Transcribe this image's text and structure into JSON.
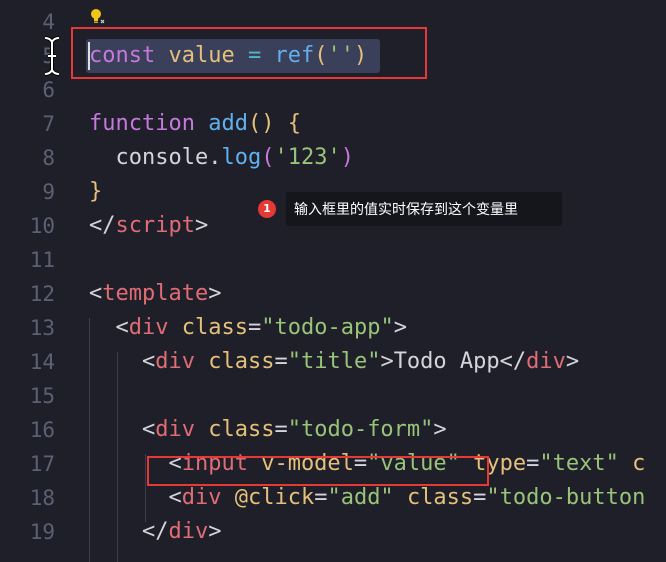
{
  "editor": {
    "lines": [
      {
        "num": "4",
        "tokens": []
      },
      {
        "num": "5",
        "tokens": [
          {
            "t": "const",
            "c": "t-kw"
          },
          {
            "t": " ",
            "c": "t-plain"
          },
          {
            "t": "value",
            "c": "t-var"
          },
          {
            "t": " ",
            "c": "t-plain"
          },
          {
            "t": "=",
            "c": "t-op"
          },
          {
            "t": " ",
            "c": "t-plain"
          },
          {
            "t": "ref",
            "c": "t-fn"
          },
          {
            "t": "(",
            "c": "t-paren"
          },
          {
            "t": "''",
            "c": "t-str"
          },
          {
            "t": ")",
            "c": "t-paren"
          }
        ]
      },
      {
        "num": "6",
        "tokens": []
      },
      {
        "num": "7",
        "tokens": [
          {
            "t": "function",
            "c": "t-kw"
          },
          {
            "t": " ",
            "c": "t-plain"
          },
          {
            "t": "add",
            "c": "t-fn"
          },
          {
            "t": "()",
            "c": "t-paren"
          },
          {
            "t": " ",
            "c": "t-plain"
          },
          {
            "t": "{",
            "c": "t-paren"
          }
        ]
      },
      {
        "num": "8",
        "tokens": [
          {
            "t": "  console",
            "c": "t-plain"
          },
          {
            "t": ".",
            "c": "t-plain"
          },
          {
            "t": "log",
            "c": "t-fn"
          },
          {
            "t": "(",
            "c": "t-kw"
          },
          {
            "t": "'123'",
            "c": "t-str"
          },
          {
            "t": ")",
            "c": "t-kw"
          }
        ]
      },
      {
        "num": "9",
        "tokens": [
          {
            "t": "}",
            "c": "t-paren"
          }
        ]
      },
      {
        "num": "10",
        "tokens": [
          {
            "t": "</",
            "c": "t-punc"
          },
          {
            "t": "script",
            "c": "t-tag"
          },
          {
            "t": ">",
            "c": "t-punc"
          }
        ]
      },
      {
        "num": "11",
        "tokens": []
      },
      {
        "num": "12",
        "tokens": [
          {
            "t": "<",
            "c": "t-punc"
          },
          {
            "t": "template",
            "c": "t-tag"
          },
          {
            "t": ">",
            "c": "t-punc"
          }
        ]
      },
      {
        "num": "13",
        "tokens": [
          {
            "t": "  <",
            "c": "t-punc"
          },
          {
            "t": "div",
            "c": "t-tag"
          },
          {
            "t": " ",
            "c": "t-plain"
          },
          {
            "t": "class",
            "c": "t-attr"
          },
          {
            "t": "=",
            "c": "t-punc"
          },
          {
            "t": "\"todo-app\"",
            "c": "t-str"
          },
          {
            "t": ">",
            "c": "t-punc"
          }
        ]
      },
      {
        "num": "14",
        "tokens": [
          {
            "t": "    <",
            "c": "t-punc"
          },
          {
            "t": "div",
            "c": "t-tag"
          },
          {
            "t": " ",
            "c": "t-plain"
          },
          {
            "t": "class",
            "c": "t-attr"
          },
          {
            "t": "=",
            "c": "t-punc"
          },
          {
            "t": "\"title\"",
            "c": "t-str"
          },
          {
            "t": ">",
            "c": "t-punc"
          },
          {
            "t": "Todo App",
            "c": "t-plain"
          },
          {
            "t": "</",
            "c": "t-punc"
          },
          {
            "t": "div",
            "c": "t-tag"
          },
          {
            "t": ">",
            "c": "t-punc"
          }
        ]
      },
      {
        "num": "15",
        "tokens": []
      },
      {
        "num": "16",
        "tokens": [
          {
            "t": "    <",
            "c": "t-punc"
          },
          {
            "t": "div",
            "c": "t-tag"
          },
          {
            "t": " ",
            "c": "t-plain"
          },
          {
            "t": "class",
            "c": "t-attr"
          },
          {
            "t": "=",
            "c": "t-punc"
          },
          {
            "t": "\"todo-form\"",
            "c": "t-str"
          },
          {
            "t": ">",
            "c": "t-punc"
          }
        ]
      },
      {
        "num": "17",
        "tokens": [
          {
            "t": "      <",
            "c": "t-punc"
          },
          {
            "t": "input",
            "c": "t-tag"
          },
          {
            "t": " ",
            "c": "t-plain"
          },
          {
            "t": "v-model",
            "c": "t-attr"
          },
          {
            "t": "=",
            "c": "t-punc"
          },
          {
            "t": "\"value\"",
            "c": "t-str"
          },
          {
            "t": " ",
            "c": "t-plain"
          },
          {
            "t": "type",
            "c": "t-attr"
          },
          {
            "t": "=",
            "c": "t-punc"
          },
          {
            "t": "\"text\"",
            "c": "t-str"
          },
          {
            "t": " c",
            "c": "t-attr"
          }
        ]
      },
      {
        "num": "18",
        "tokens": [
          {
            "t": "      <",
            "c": "t-punc"
          },
          {
            "t": "div",
            "c": "t-tag"
          },
          {
            "t": " ",
            "c": "t-plain"
          },
          {
            "t": "@click",
            "c": "t-attr"
          },
          {
            "t": "=",
            "c": "t-punc"
          },
          {
            "t": "\"add\"",
            "c": "t-str"
          },
          {
            "t": " ",
            "c": "t-plain"
          },
          {
            "t": "class",
            "c": "t-attr"
          },
          {
            "t": "=",
            "c": "t-punc"
          },
          {
            "t": "\"todo-button",
            "c": "t-str"
          }
        ]
      },
      {
        "num": "19",
        "tokens": [
          {
            "t": "    </",
            "c": "t-punc"
          },
          {
            "t": "div",
            "c": "t-tag"
          },
          {
            "t": ">",
            "c": "t-punc"
          }
        ]
      }
    ]
  },
  "annotation": {
    "badge_number": "1",
    "tooltip_text": "输入框里的值实时保存到这个变量里"
  },
  "icons": {
    "lightbulb": "lightbulb-icon",
    "text_cursor": "text-cursor-icon"
  },
  "colors": {
    "background": "#1e1f28",
    "highlight_box": "#e53935",
    "keyword": "#c678dd",
    "string": "#98c379",
    "function": "#61afef",
    "tag": "#e06c75"
  }
}
